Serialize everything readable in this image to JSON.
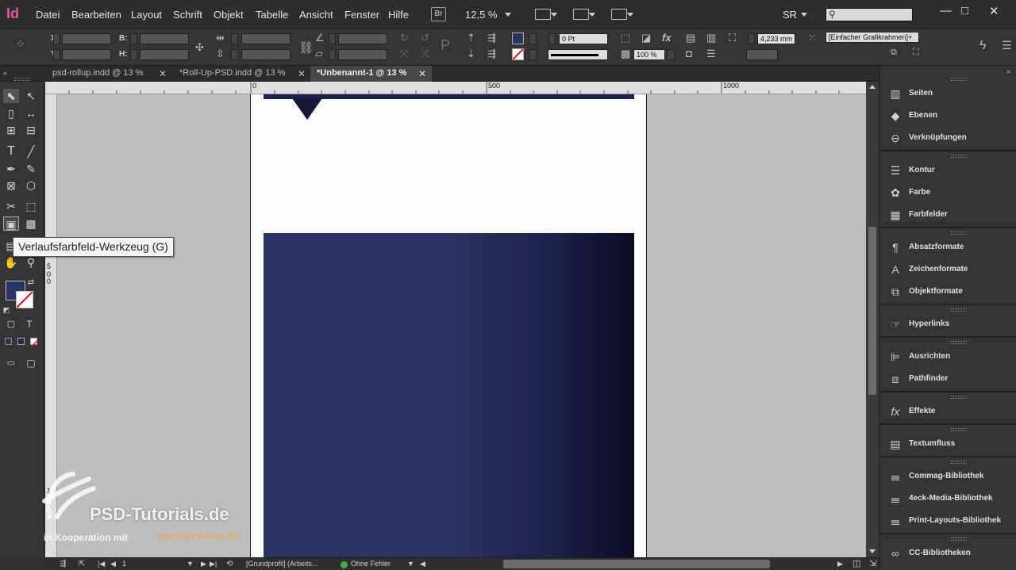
{
  "app": {
    "logo_text": "Id"
  },
  "menubar": {
    "items": [
      "Datei",
      "Bearbeiten",
      "Layout",
      "Schrift",
      "Objekt",
      "Tabelle",
      "Ansicht",
      "Fenster",
      "Hilfe"
    ],
    "bridge_badge": "Br",
    "zoom": "12,5 %",
    "workspace": "SR",
    "search_placeholder": "",
    "window_controls": [
      "minimize-icon",
      "maximize-icon",
      "close-icon"
    ]
  },
  "controlbar": {
    "x_label": "X:",
    "y_label": "Y:",
    "w_label": "B:",
    "h_label": "H:",
    "stroke_weight": "0 Pt",
    "opacity": "100 %",
    "frame_width": "4,233 mm",
    "object_style": "[Einfacher Grafikrahmen]+",
    "fill_color": "#283462",
    "stroke_color": "none"
  },
  "tabs": [
    {
      "label": "psd-rollup.indd @ 13 %",
      "active": false
    },
    {
      "label": "*Roll-Up-PSD.indd @ 13 %",
      "active": false
    },
    {
      "label": "*Unbenannt-1 @ 13 %",
      "active": true
    }
  ],
  "tools": {
    "tooltip": "Verlaufsfarbfeld-Werkzeug (G)"
  },
  "ruler": {
    "top_labels": [
      "0",
      "500",
      "1000"
    ],
    "left_labels": [
      "5",
      "0",
      "0",
      "1",
      "0",
      "0",
      "0",
      "1"
    ]
  },
  "document": {
    "page_bg": "#fbfbf9",
    "top_bar_color": "#1c2250",
    "gradient_start": "#283462",
    "gradient_end": "#0a0c22"
  },
  "watermark": {
    "title": "PSD-Tutorials.de",
    "cooperation": "in Kooperation mit",
    "partner": "diedruckerei.de"
  },
  "statusbar": {
    "page_number": "1",
    "profile": "[Grundprofil] (Arbeits...",
    "preflight": "Ohne Fehler",
    "preflight_color": "#3fb33f"
  },
  "panels": {
    "groups": [
      [
        {
          "label": "Seiten",
          "icon": "pages-icon"
        },
        {
          "label": "Ebenen",
          "icon": "layers-icon"
        },
        {
          "label": "Verknüpfungen",
          "icon": "links-icon"
        }
      ],
      [
        {
          "label": "Kontur",
          "icon": "stroke-icon"
        },
        {
          "label": "Farbe",
          "icon": "color-icon"
        },
        {
          "label": "Farbfelder",
          "icon": "swatches-icon"
        }
      ],
      [
        {
          "label": "Absatzformate",
          "icon": "paragraph-styles-icon"
        },
        {
          "label": "Zeichenformate",
          "icon": "character-styles-icon"
        },
        {
          "label": "Objektformate",
          "icon": "object-styles-icon"
        }
      ],
      [
        {
          "label": "Hyperlinks",
          "icon": "hyperlinks-icon"
        }
      ],
      [
        {
          "label": "Ausrichten",
          "icon": "align-icon"
        },
        {
          "label": "Pathfinder",
          "icon": "pathfinder-icon"
        }
      ],
      [
        {
          "label": "Effekte",
          "icon": "effects-icon"
        }
      ],
      [
        {
          "label": "Textumfluss",
          "icon": "text-wrap-icon"
        }
      ],
      [
        {
          "label": "Commag-Bibliothek",
          "icon": "library-icon"
        },
        {
          "label": "4eck-Media-Bibliothek",
          "icon": "library-icon"
        },
        {
          "label": "Print-Layouts-Bibliothek",
          "icon": "library-icon"
        }
      ],
      [
        {
          "label": "CC-Bibliotheken",
          "icon": "cc-libraries-icon"
        }
      ]
    ]
  }
}
